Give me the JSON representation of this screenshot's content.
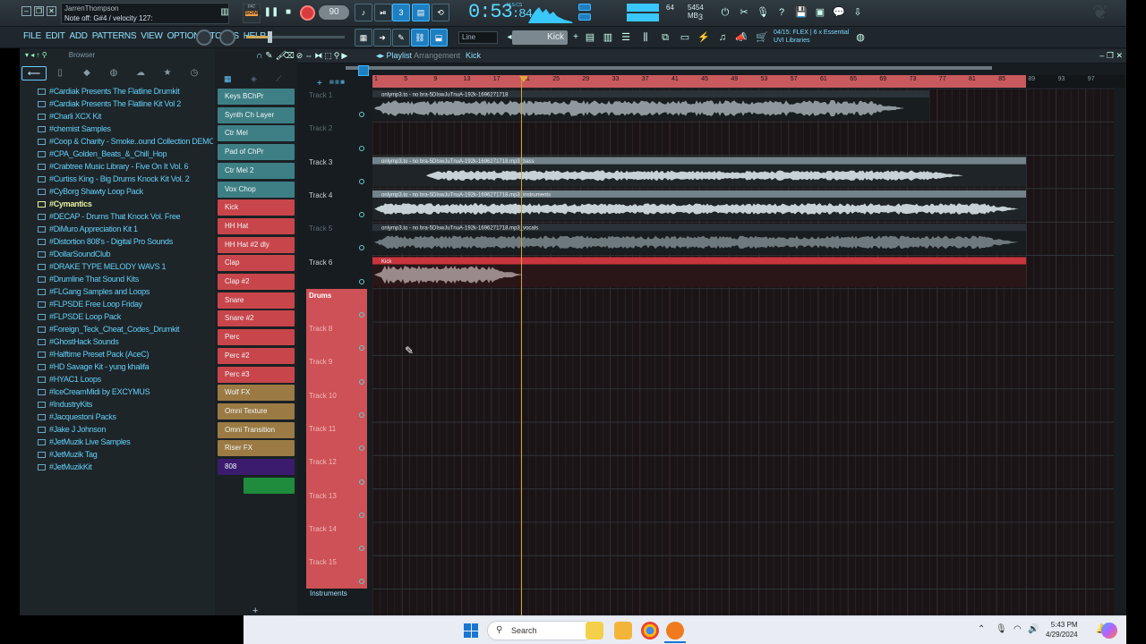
{
  "hint": {
    "line1": "JarrenThompson",
    "line2": "Note off: G#4 / velocity 127:"
  },
  "pattern_button": {
    "label": "PAT",
    "state": "SONG"
  },
  "tempo": "90",
  "time": {
    "main": "0:53",
    "sub": ":84",
    "unit": "M:S:CS"
  },
  "cpu": {
    "value": "64",
    "memory": "5454 MB",
    "polyphony": "3"
  },
  "menu": [
    "FILE",
    "EDIT",
    "ADD",
    "PATTERNS",
    "VIEW",
    "OPTIONS",
    "TOOLS",
    "HELP"
  ],
  "snap": "Line",
  "pattern_selector": "Kick",
  "news": {
    "line1": "04/15: FLEX | 6 x Essential",
    "line2": "UVI Libraries"
  },
  "browser": {
    "title": "Browser",
    "items": [
      "#Cardiak Presents The Flatline Drumkit",
      "#Cardiak Presents The Flatline Kit Vol 2",
      "#Charli XCX Kit",
      "#chemist Samples",
      "#Coop & Charity - Smoke..ound Collection DEMO KIT",
      "#CPA_Golden_Beats_&_Chill_Hop",
      "#Crabtree Music Library - Five On It Vol. 6",
      "#Curtiss King - Big Drums Knock Kit Vol. 2",
      "#CyBorg Shawty Loop Pack",
      "#Cymantics",
      "#DECAP - Drums That Knock Vol. Free",
      "#DiMuro Appreciation Kit 1",
      "#Distortion 808's - Digital Pro Sounds",
      "#DollarSoundClub",
      "#DRAKE TYPE MELODY WAVS 1",
      "#Drumline That Sound Kits",
      "#FLGang Samples and Loops",
      "#FLPSDE Free Loop Friday",
      "#FLPSDE Loop Pack",
      "#Foreign_Teck_Cheat_Codes_Drumkit",
      "#GhostHack Sounds",
      "#Halftime Preset Pack (AceC)",
      "#HD Savage Kit - yung khalifa",
      "#HYAC1 Loops",
      "#IceCreamMidi by EXCYMUS",
      "#IndustryKits",
      "#Jacquestoni Packs",
      "#Jake J Johnson",
      "#JetMuzik Live Samples",
      "#JetMuzik Tag",
      "#JetMuzikKit"
    ],
    "selected_index": 9
  },
  "channels": [
    {
      "name": "Keys BChPr",
      "color": "teal"
    },
    {
      "name": "Synth Ch Layer",
      "color": "teal"
    },
    {
      "name": "Ctr Mel",
      "color": "teal"
    },
    {
      "name": "Pad of ChPr",
      "color": "teal"
    },
    {
      "name": "Ctr Mel 2",
      "color": "teal"
    },
    {
      "name": "Vox Chop",
      "color": "teal"
    },
    {
      "name": "Kick",
      "color": "red"
    },
    {
      "name": "HH Hat",
      "color": "red"
    },
    {
      "name": "HH Hat #2 dly",
      "color": "red"
    },
    {
      "name": "Clap",
      "color": "red"
    },
    {
      "name": "Clap #2",
      "color": "red"
    },
    {
      "name": "Snare",
      "color": "red"
    },
    {
      "name": "Snare #2",
      "color": "red"
    },
    {
      "name": "Perc",
      "color": "red"
    },
    {
      "name": "Perc #2",
      "color": "red"
    },
    {
      "name": "Perc #3",
      "color": "red"
    },
    {
      "name": "Wolf FX",
      "color": "gold"
    },
    {
      "name": "Omni Texture",
      "color": "gold"
    },
    {
      "name": "Omni Transition",
      "color": "gold"
    },
    {
      "name": "Riser FX",
      "color": "gold"
    },
    {
      "name": "808",
      "color": "purple"
    },
    {
      "name": "",
      "color": "green"
    }
  ],
  "playlist": {
    "title": "Playlist",
    "subtitle": "Arrangement",
    "pattern": "Kick",
    "ruler": [
      "1",
      "5",
      "9",
      "13",
      "17",
      "21",
      "25",
      "29",
      "33",
      "37",
      "41",
      "45",
      "49",
      "53",
      "57",
      "61",
      "65",
      "69",
      "73",
      "77",
      "81",
      "85",
      "89",
      "93",
      "97"
    ],
    "tracks": [
      "Track 1",
      "Track 2",
      "Track 3",
      "Track 4",
      "Track 5",
      "Track 6",
      "Drums",
      "Track 8",
      "Track 9",
      "Track 10",
      "Track 11",
      "Track 12",
      "Track 13",
      "Track 14",
      "Track 15"
    ],
    "section_label": "Instruments",
    "clips": [
      {
        "track": 0,
        "label": "onlymp3.to - no bra-5DIswJuTnuA-192k-1696271718"
      },
      {
        "track": 2,
        "label": "onlymp3.to - no bra-5DIswJuTnuA-192k-1696271718.mp3_bass"
      },
      {
        "track": 3,
        "label": "onlymp3.to - no bra-5DIswJuTnuA-192k-1696271718.mp3_instruments"
      },
      {
        "track": 4,
        "label": "onlymp3.to - no bra-5DIswJuTnuA-192k-1696271718.mp3_vocals"
      },
      {
        "track": 5,
        "label": "Kick"
      }
    ]
  },
  "taskbar": {
    "search": "Search",
    "time": "5:43 PM",
    "date": "4/29/2024"
  }
}
